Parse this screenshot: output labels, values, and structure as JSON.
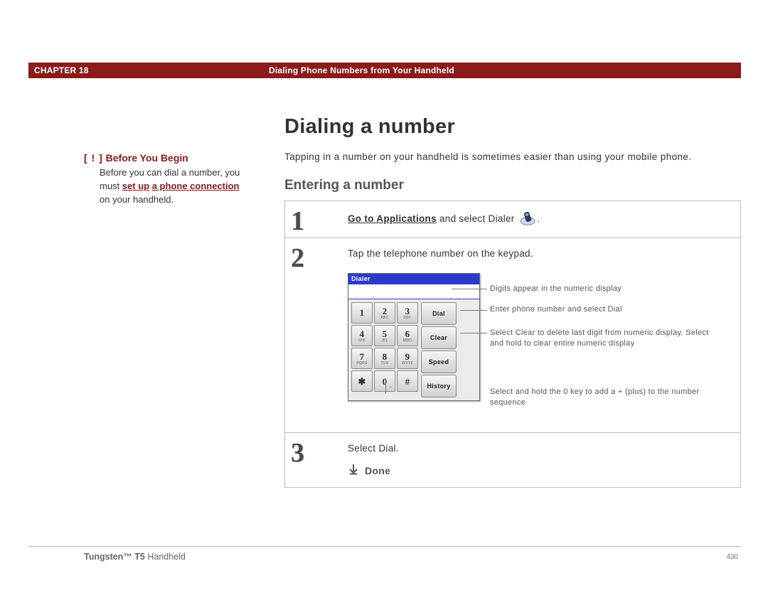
{
  "header": {
    "chapter_label": "CHAPTER 18",
    "chapter_title": "Dialing Phone Numbers from Your Handheld"
  },
  "sidebar": {
    "bracket": "[ ! ]",
    "title": "Before You Begin",
    "body_pre": "Before you can dial a number, you must ",
    "link1": "set up",
    "link2": "a phone connection",
    "body_post": " on your handheld."
  },
  "main": {
    "h1": "Dialing a number",
    "intro": "Tapping in a number on your handheld is sometimes easier than using your mobile phone.",
    "h2": "Entering a number"
  },
  "steps": [
    {
      "num": "1",
      "pre_link": "Go to Applications",
      "post": " and select Dialer ",
      "tail": "."
    },
    {
      "num": "2",
      "text": "Tap the telephone number on the keypad."
    },
    {
      "num": "3",
      "text": "Select Dial."
    }
  ],
  "dialer": {
    "title": "Dialer",
    "keys": [
      {
        "n": "1",
        "s": ""
      },
      {
        "n": "2",
        "s": "ABC"
      },
      {
        "n": "3",
        "s": "DEF"
      },
      {
        "n": "4",
        "s": "GHI"
      },
      {
        "n": "5",
        "s": "JKL"
      },
      {
        "n": "6",
        "s": "MNO"
      },
      {
        "n": "7",
        "s": "PQRS"
      },
      {
        "n": "8",
        "s": "TUV"
      },
      {
        "n": "9",
        "s": "WXYZ"
      },
      {
        "n": "✱",
        "s": ""
      },
      {
        "n": "0",
        "s": "+"
      },
      {
        "n": "#",
        "s": ""
      }
    ],
    "sidebtns": [
      "Dial",
      "Clear",
      "Speed",
      "History"
    ]
  },
  "callouts": {
    "c1": "Digits appear in the numeric display",
    "c2": "Enter phone number and select Dial",
    "c3": "Select Clear to delete last digit from numeric display. Select and hold to clear entire numeric display",
    "c4": "Select and hold the 0 key to add a + (plus) to the number sequence"
  },
  "done": "Done",
  "footer": {
    "product_bold": "Tungsten™ T5",
    "product_rest": " Handheld",
    "page": "430"
  }
}
